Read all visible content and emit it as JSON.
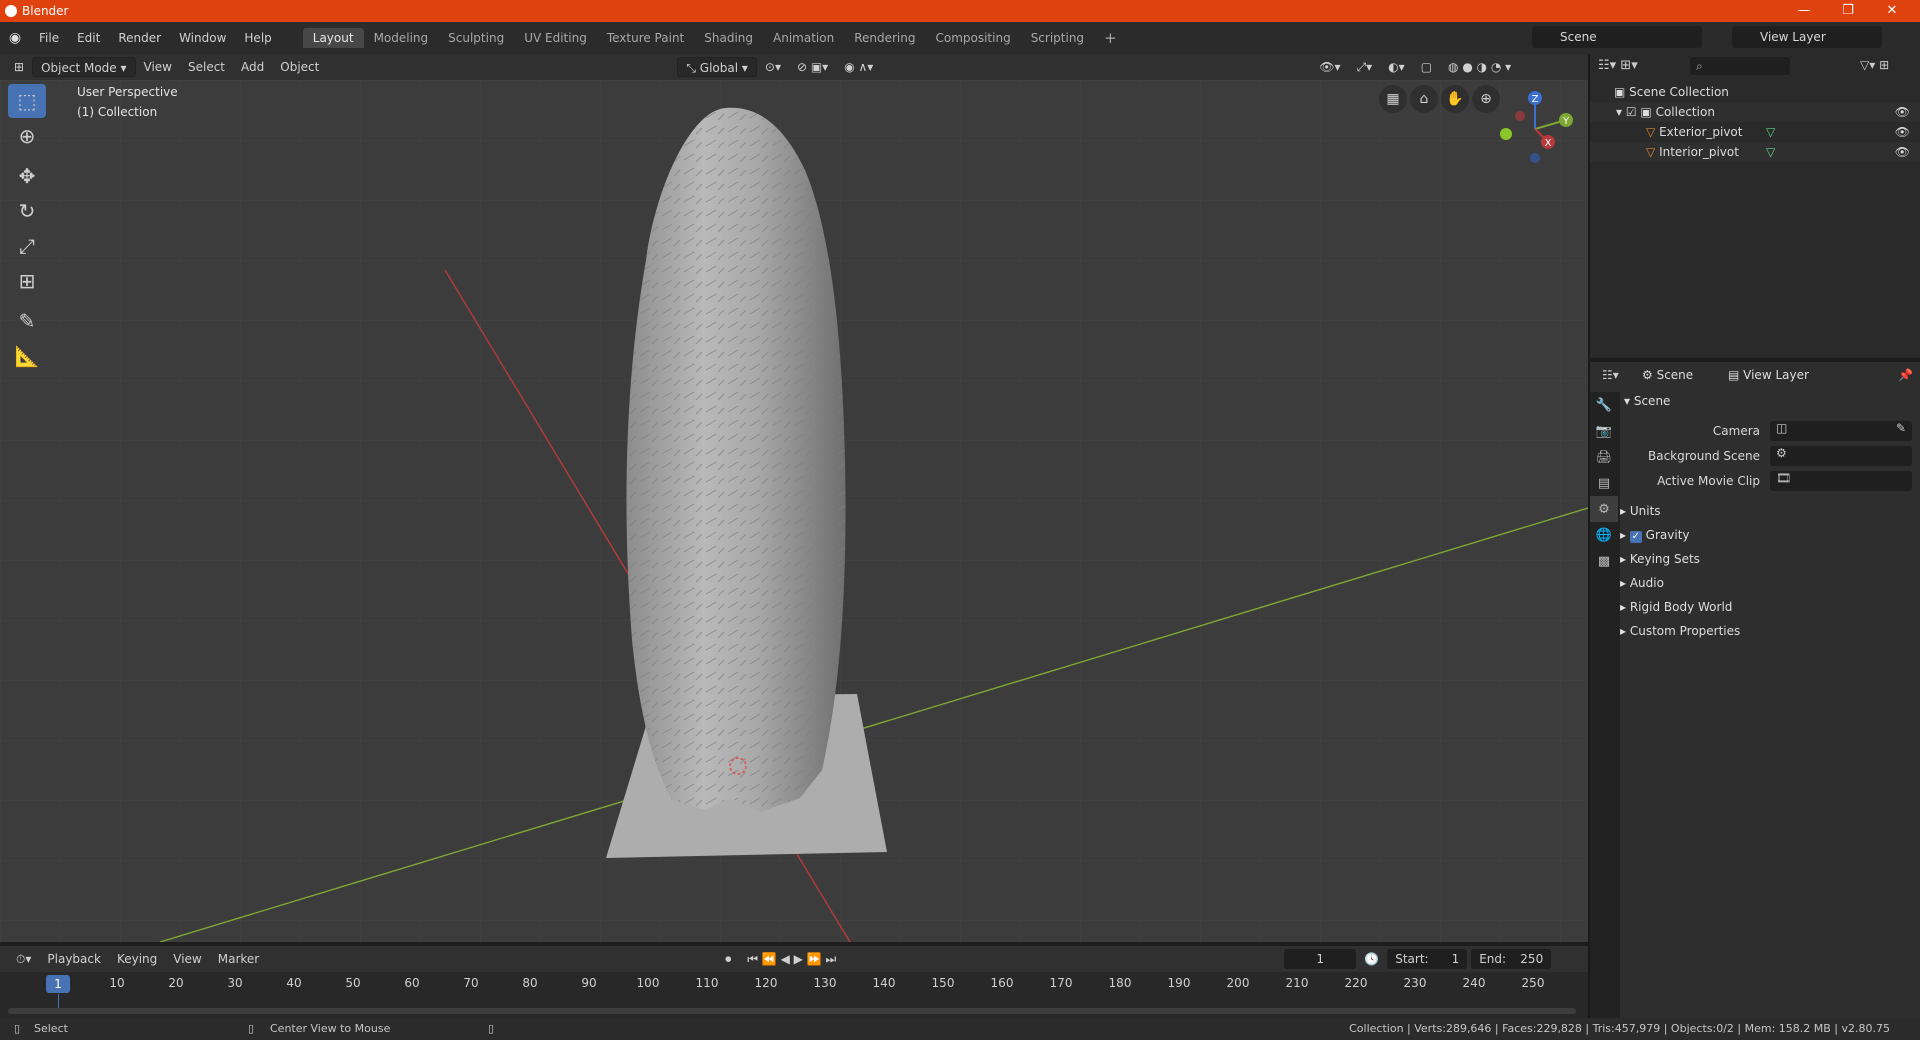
{
  "window": {
    "title": "Blender",
    "minimize": "—",
    "maximize": "❐",
    "close": "✕"
  },
  "menus": [
    "File",
    "Edit",
    "Render",
    "Window",
    "Help"
  ],
  "workspaces": [
    "Layout",
    "Modeling",
    "Sculpting",
    "UV Editing",
    "Texture Paint",
    "Shading",
    "Animation",
    "Rendering",
    "Compositing",
    "Scripting"
  ],
  "add_workspace": "+",
  "scene_name": "Scene",
  "view_layer_name": "View Layer",
  "viewport": {
    "mode": "Object Mode",
    "menus": [
      "View",
      "Select",
      "Add",
      "Object"
    ],
    "orientation": "Global",
    "perspective_label": "User Perspective",
    "collection_label": "(1) Collection",
    "gizmo": {
      "x": "X",
      "y": "Y",
      "z": "Z"
    }
  },
  "timeline": {
    "menus": [
      "Playback",
      "Keying",
      "View",
      "Marker"
    ],
    "current_frame": "1",
    "start_label": "Start:",
    "start": "1",
    "end_label": "End:",
    "end": "250",
    "ticks": [
      "10",
      "20",
      "30",
      "40",
      "50",
      "60",
      "70",
      "80",
      "90",
      "100",
      "110",
      "120",
      "130",
      "140",
      "150",
      "160",
      "170",
      "180",
      "190",
      "200",
      "210",
      "220",
      "230",
      "240",
      "250"
    ]
  },
  "status": {
    "left": "Select",
    "middle": "Center View to Mouse",
    "right": "Collection | Verts:289,646 | Faces:229,828 | Tris:457,979 | Objects:0/2 | Mem: 158.2 MB | v2.80.75"
  },
  "outliner": {
    "root": "Scene Collection",
    "collection": "Collection",
    "objects": [
      "Exterior_pivot",
      "Interior_pivot"
    ]
  },
  "properties": {
    "breadcrumb_scene": "Scene",
    "breadcrumb_view_layer": "View Layer",
    "panel_title": "Scene",
    "fields": [
      "Camera",
      "Background Scene",
      "Active Movie Clip"
    ],
    "subpanels": [
      "Units",
      "Gravity",
      "Keying Sets",
      "Audio",
      "Rigid Body World",
      "Custom Properties"
    ]
  },
  "colors": {
    "accent": "#4772b3",
    "titlebar": "#e0420f",
    "x_axis": "#b83a3a",
    "y_axis": "#7ea832",
    "z_axis": "#3b6fd0"
  }
}
